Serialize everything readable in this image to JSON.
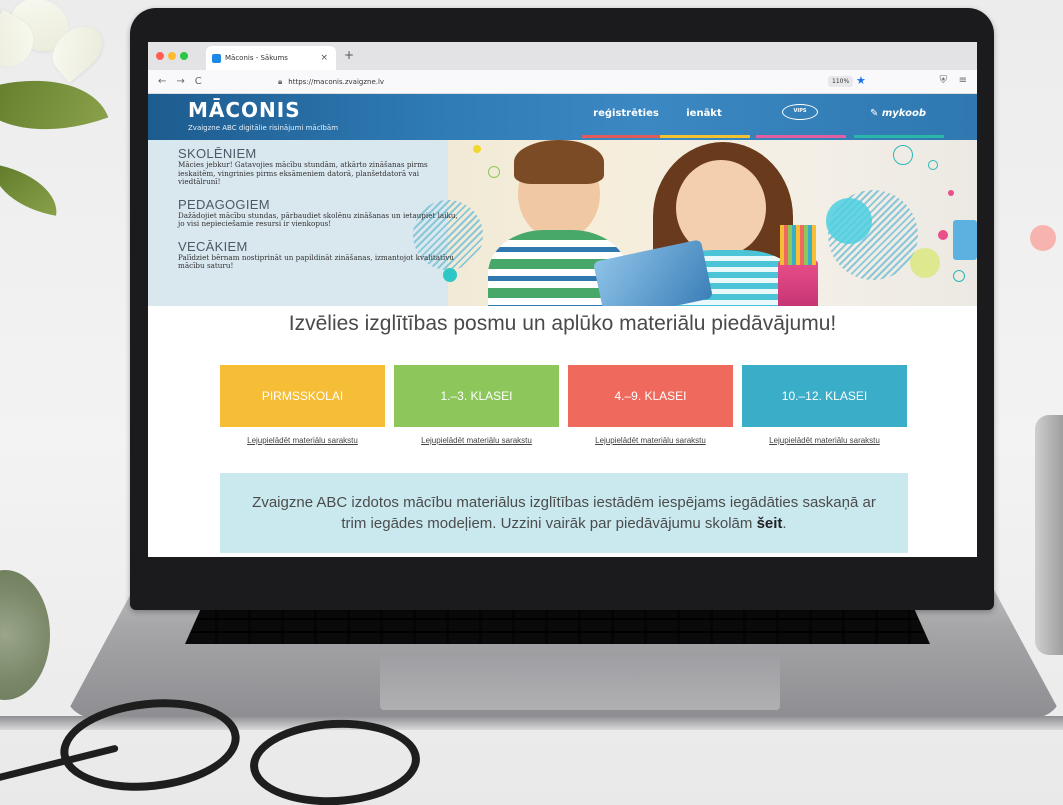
{
  "browser": {
    "tab_title": "Māconis - Sākums",
    "tab_close": "×",
    "new_tab": "+",
    "back": "←",
    "forward": "→",
    "reload": "C",
    "url": "https://maconis.zvaigzne.lv",
    "zoom": "110%",
    "bookmark": "★",
    "shield": "⛨",
    "menu": "≡",
    "colors": {
      "close": "#ff5f57",
      "minimize": "#febc2e",
      "maximize": "#28c840"
    }
  },
  "site": {
    "logo_title": "MĀCONIS",
    "logo_subtitle": "Zvaigzne ABC digitālie risinājumi mācībām",
    "nav": [
      {
        "label": "reģistrēties",
        "color": "#e35a5a"
      },
      {
        "label": "ienākt",
        "color": "#f2c230"
      },
      {
        "label": "VIPS",
        "color": "#e15fa0"
      },
      {
        "label": "mykoob",
        "color": "#2bb7a8"
      }
    ]
  },
  "hero": {
    "sections": [
      {
        "heading": "SKOLĒNIEM",
        "text": "Mācies jebkur! Gatavojies mācību stundām, atkārto zināšanas pirms ieskaitēm, vingrinies pirms eksāmeniem datorā, planšetdatorā vai viedtālrunī!"
      },
      {
        "heading": "PEDAGOGIEM",
        "text": "Dažādojiet mācību stundas, pārbaudiet skolēnu zināšanas un ietaupiet laiku, jo visi nepieciešamie resursi ir vienkopus!"
      },
      {
        "heading": "VECĀKIEM",
        "text": "Palīdziet bērnam nostiprināt un papildināt zināšanas, izmantojot kvalitatīvu mācību saturu!"
      }
    ]
  },
  "main": {
    "heading": "Izvēlies izglītības posmu un aplūko materiālu piedāvājumu!",
    "levels": [
      {
        "label": "PIRMSSKOLAI",
        "color": "#f6bd36",
        "link": "Lejupielādēt materiālu sarakstu"
      },
      {
        "label": "1.–3. KLASEI",
        "color": "#8dc65a",
        "link": "Lejupielādēt materiālu sarakstu"
      },
      {
        "label": "4.–9. KLASEI",
        "color": "#ef6a5c",
        "link": "Lejupielādēt materiālu sarakstu"
      },
      {
        "label": "10.–12. KLASEI",
        "color": "#3aaec8",
        "link": "Lejupielādēt materiālu sarakstu"
      }
    ],
    "info_text": "Zvaigzne ABC izdotos mācību materiālus izglītības iestādēm iespējams iegādāties saskaņā ar trim iegādes modeļiem. Uzzini vairāk par piedāvājumu skolām",
    "info_link": "šeit",
    "info_end": "."
  }
}
